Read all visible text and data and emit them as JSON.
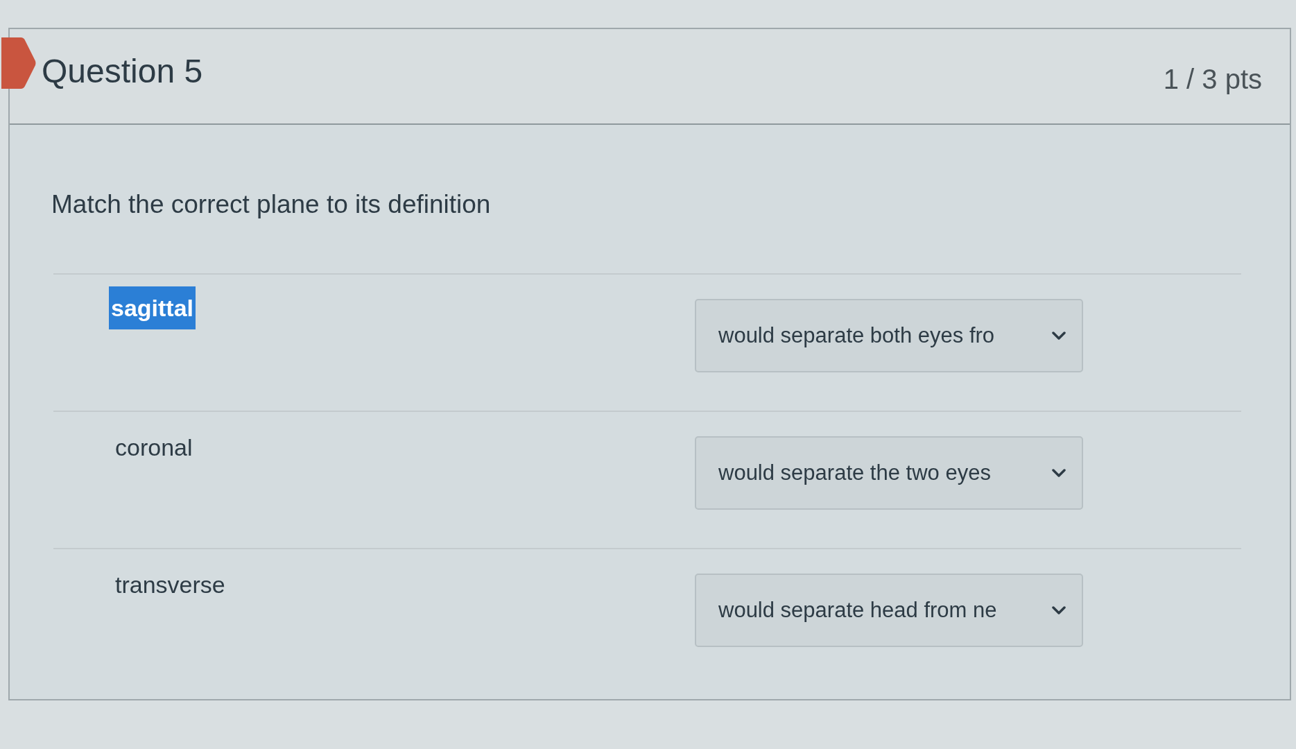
{
  "question": {
    "title": "Question 5",
    "points": "1 / 3 pts",
    "flagged": true,
    "prompt": "Match the correct plane to its definition",
    "matches": [
      {
        "term": "sagittal",
        "highlighted": true,
        "answer": "would separate both eyes fro"
      },
      {
        "term": "coronal",
        "highlighted": false,
        "answer": "would separate the two eyes"
      },
      {
        "term": "transverse",
        "highlighted": false,
        "answer": "would separate head from ne"
      }
    ]
  }
}
